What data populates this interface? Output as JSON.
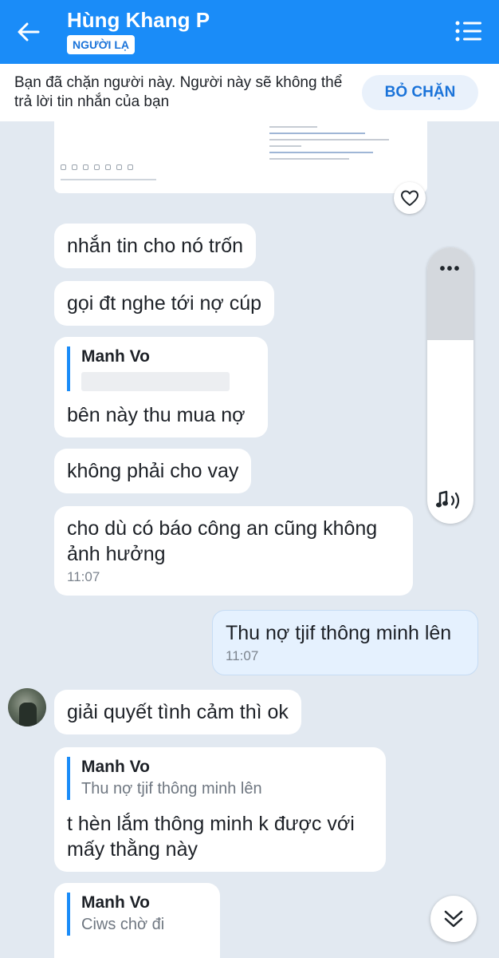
{
  "header": {
    "title": "Hùng Khang P",
    "badge": "NGƯỜI LẠ",
    "back_icon": "arrow-left-icon",
    "menu_icon": "list-menu-icon",
    "background": "#1a8cf8"
  },
  "banner": {
    "text": "Bạn đã chặn người này. Người này sẽ không thể trả lời tin nhắn của bạn",
    "button": "BỎ CHẶN"
  },
  "scroll_widget": {
    "dots": "•••",
    "sound_icon": "speaker-icon"
  },
  "messages": [
    {
      "text": "nhắn tin cho nó trốn"
    },
    {
      "text": "gọi đt nghe tới nợ cúp"
    },
    {
      "quote_name": "Manh Vo",
      "text": "bên  này thu mua nợ"
    },
    {
      "text": "không phải cho vay"
    },
    {
      "line1": "cho dù có báo công an cũng không",
      "line2": "ảnh hưởng",
      "time": "11:07"
    },
    {
      "text": "Thu nợ tjif thông minh lên",
      "time": "11:07",
      "mine": true
    },
    {
      "text": "giải quyết tình cảm thì ok"
    },
    {
      "quote_name": "Manh Vo",
      "quote_text": "Thu nợ tjif thông minh lên",
      "line1": "t hèn lắm thông minh k được với",
      "line2": "mấy thằng này"
    },
    {
      "quote_name": "Manh Vo",
      "quote_text": "Ciws chờ đi"
    }
  ],
  "colors": {
    "accent": "#1a8cf8",
    "chat_bg": "#e2e9f1",
    "my_bubble": "#e5f1fe"
  }
}
